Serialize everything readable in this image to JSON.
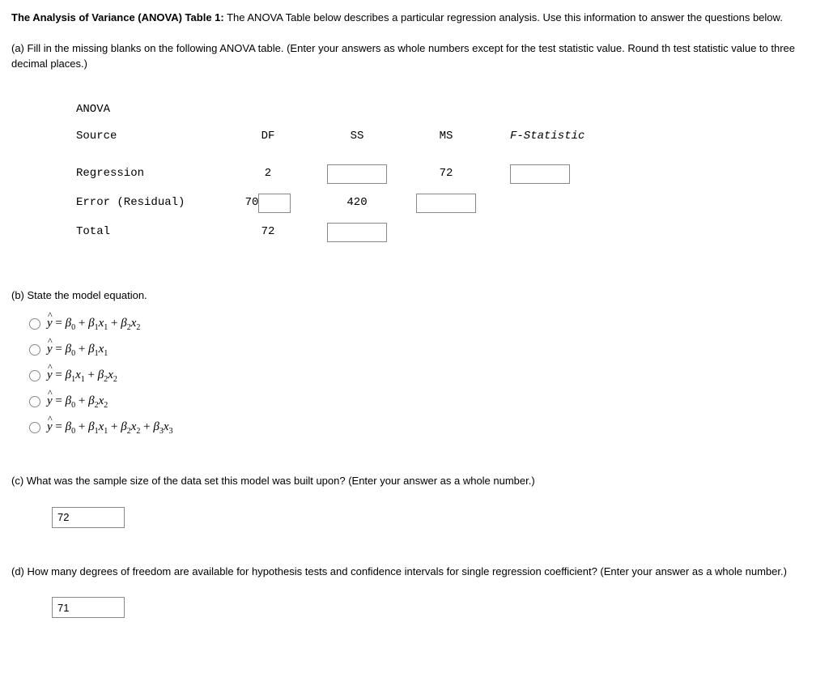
{
  "intro": {
    "title_bold": "The Analysis of Variance (ANOVA) Table 1:",
    "title_rest": " The ANOVA Table below describes a particular regression analysis. Use this information to answer the questions below."
  },
  "partA": {
    "prompt": "(a) Fill in the missing blanks on the following ANOVA table. (Enter your answers as whole numbers except for the test statistic value. Round th test statistic value to three decimal places.)"
  },
  "anova": {
    "heading": "ANOVA",
    "headers": {
      "source": "Source",
      "df": "DF",
      "ss": "SS",
      "ms": "MS",
      "fstat": "F-Statistic"
    },
    "rows": {
      "regression": {
        "label": "Regression",
        "df": "2",
        "ss": "",
        "ms": "72",
        "fstat": ""
      },
      "error": {
        "label": "Error (Residual)",
        "df_prefix": "70",
        "df": "",
        "ss": "420",
        "ms": "",
        "fstat": ""
      },
      "total": {
        "label": "Total",
        "df": "72",
        "ss": "",
        "ms": "",
        "fstat": ""
      }
    }
  },
  "partB": {
    "prompt": "(b) State the model equation.",
    "options": [
      "ŷ = β₀ + β₁x₁ + β₂x₂",
      "ŷ = β₀ + β₁x₁",
      "ŷ = β₁x₁ + β₂x₂",
      "ŷ = β₀ + β₂x₂",
      "ŷ = β₀ + β₁x₁ + β₂x₂ + β₃x₃"
    ]
  },
  "partC": {
    "prompt": "(c) What was the sample size of the data set this model was built upon? (Enter your answer as a whole number.)",
    "value": "72"
  },
  "partD": {
    "prompt": "(d) How many degrees of freedom are available for hypothesis tests and confidence intervals for single regression coefficient? (Enter your answer as a whole number.)",
    "value": "71"
  }
}
